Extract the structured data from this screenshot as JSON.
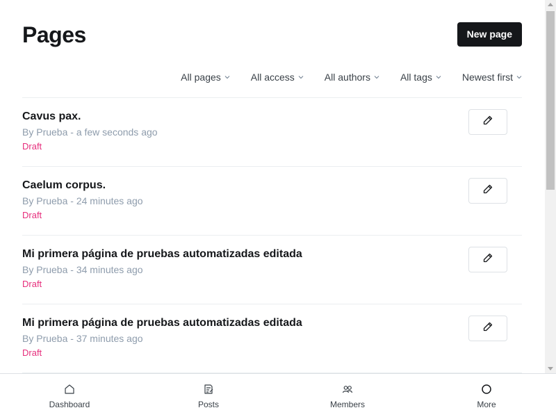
{
  "header": {
    "title": "Pages",
    "new_button_label": "New page"
  },
  "filters": [
    {
      "label": "All pages",
      "name": "filter-type"
    },
    {
      "label": "All access",
      "name": "filter-access"
    },
    {
      "label": "All authors",
      "name": "filter-author"
    },
    {
      "label": "All tags",
      "name": "filter-tag"
    },
    {
      "label": "Newest first",
      "name": "filter-sort"
    }
  ],
  "pages": [
    {
      "title": "Cavus pax.",
      "meta": "By Prueba - a few seconds ago",
      "status": "Draft"
    },
    {
      "title": "Caelum corpus.",
      "meta": "By Prueba - 24 minutes ago",
      "status": "Draft"
    },
    {
      "title": "Mi primera página de pruebas automatizadas editada",
      "meta": "By Prueba - 34 minutes ago",
      "status": "Draft"
    },
    {
      "title": "Mi primera página de pruebas automatizadas editada",
      "meta": "By Prueba - 37 minutes ago",
      "status": "Draft"
    }
  ],
  "bottom_nav": [
    {
      "label": "Dashboard",
      "icon": "home-icon"
    },
    {
      "label": "Posts",
      "icon": "posts-icon"
    },
    {
      "label": "Members",
      "icon": "members-icon"
    },
    {
      "label": "More",
      "icon": "more-icon"
    }
  ],
  "colors": {
    "accent_draft": "#e62e7c",
    "primary_button": "#15171a"
  }
}
